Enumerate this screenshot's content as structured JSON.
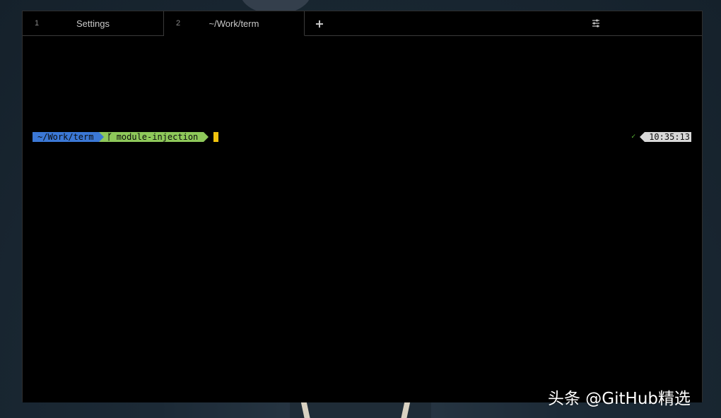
{
  "tabs": [
    {
      "number": "1",
      "title": "Settings"
    },
    {
      "number": "2",
      "title": "~/Work/term"
    }
  ],
  "new_tab_label": "+",
  "settings_icon": "sliders-icon",
  "prompt": {
    "directory": "~/Work/term",
    "branch_icon": "ᚴ",
    "branch": "module-injection"
  },
  "right_prompt": {
    "status": "✓",
    "time": "10:35:13"
  },
  "watermark": "头条 @GitHub精选",
  "colors": {
    "directory_segment": "#3b78d6",
    "git_segment": "#8ec85a",
    "cursor": "#f2c40e",
    "time_segment": "#d8d8d8",
    "status_ok": "#5fbf3a"
  }
}
